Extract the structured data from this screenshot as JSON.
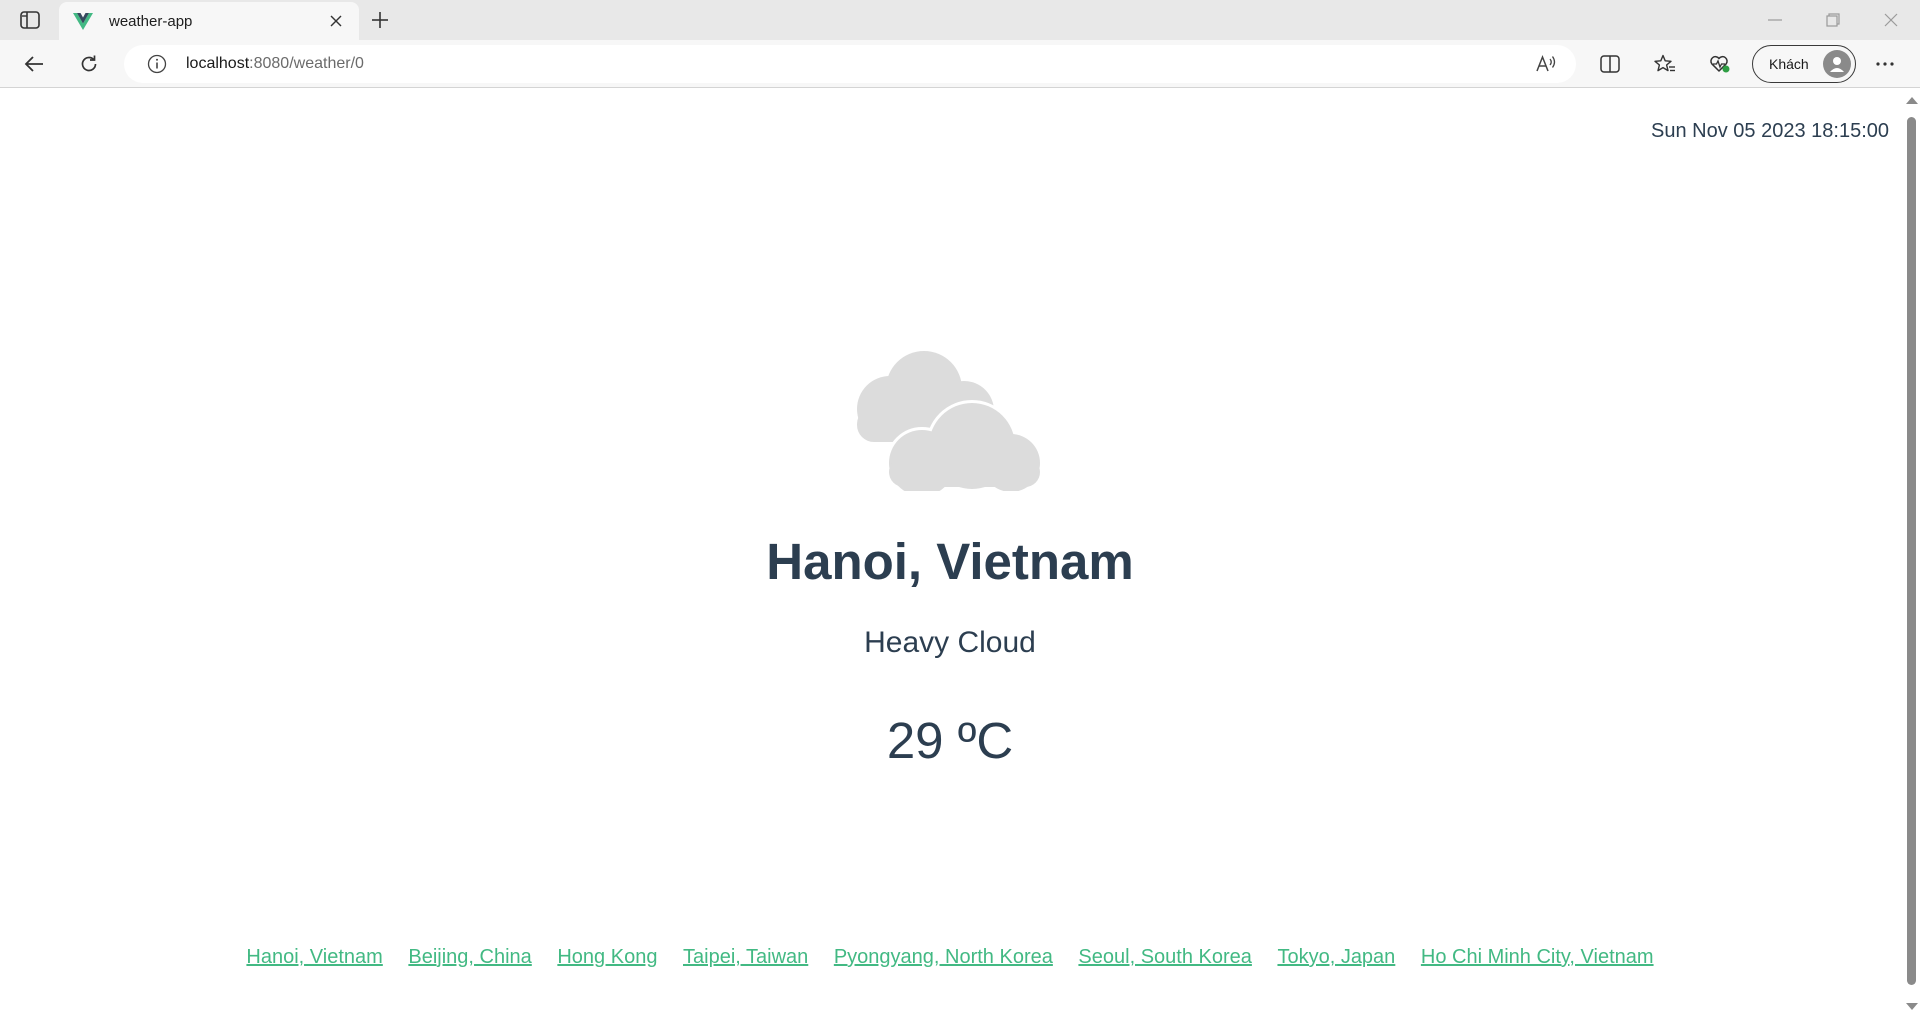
{
  "browser": {
    "tab_title": "weather-app",
    "url_host": "localhost",
    "url_rest": ":8080/weather/0",
    "profile_label": "Khách"
  },
  "page": {
    "datetime": "Sun Nov 05 2023 18:15:00",
    "weather_icon": "heavy-cloud-icon",
    "city": "Hanoi, Vietnam",
    "condition": "Heavy Cloud",
    "temperature": "29 ºC",
    "links": [
      "Hanoi, Vietnam",
      "Beijing, China",
      "Hong Kong",
      "Taipei, Taiwan",
      "Pyongyang, North Korea",
      "Seoul, South Korea",
      "Tokyo, Japan",
      "Ho Chi Minh City, Vietnam"
    ]
  },
  "colors": {
    "text": "#2c3e50",
    "link": "#42b983",
    "cloud": "#dcdcdc"
  }
}
